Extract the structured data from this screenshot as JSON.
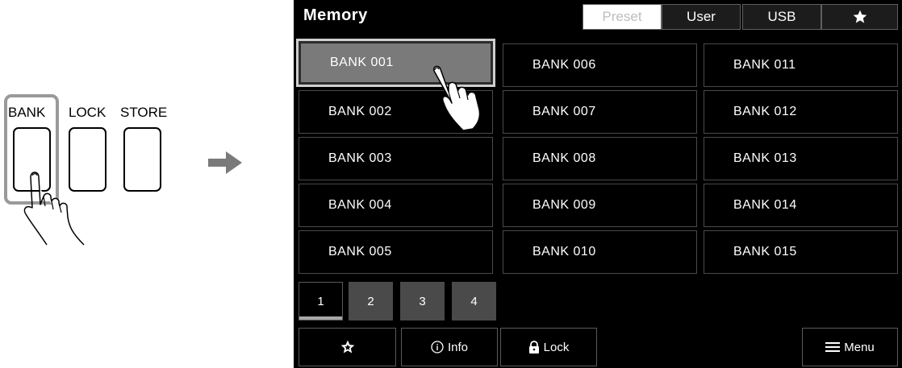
{
  "panel": {
    "labels": {
      "bank": "BANK",
      "lock": "LOCK",
      "store": "STORE"
    }
  },
  "screen": {
    "title": "Memory",
    "tabs": {
      "preset": "Preset",
      "user": "User",
      "usb": "USB",
      "favorite_icon": "star-icon"
    },
    "banks": [
      "BANK 001",
      "BANK 002",
      "BANK 003",
      "BANK 004",
      "BANK 005",
      "BANK 006",
      "BANK 007",
      "BANK 008",
      "BANK 009",
      "BANK 010",
      "BANK 011",
      "BANK 012",
      "BANK 013",
      "BANK 014",
      "BANK 015"
    ],
    "selected_bank": "BANK 001",
    "pages": [
      "1",
      "2",
      "3",
      "4"
    ],
    "active_page": "1",
    "bottom": {
      "info": "Info",
      "lock": "Lock",
      "menu": "Menu"
    }
  },
  "colors": {
    "screen_bg": "#000000",
    "selected": "#7a7a7a",
    "highlight": "#9a9a9a"
  }
}
